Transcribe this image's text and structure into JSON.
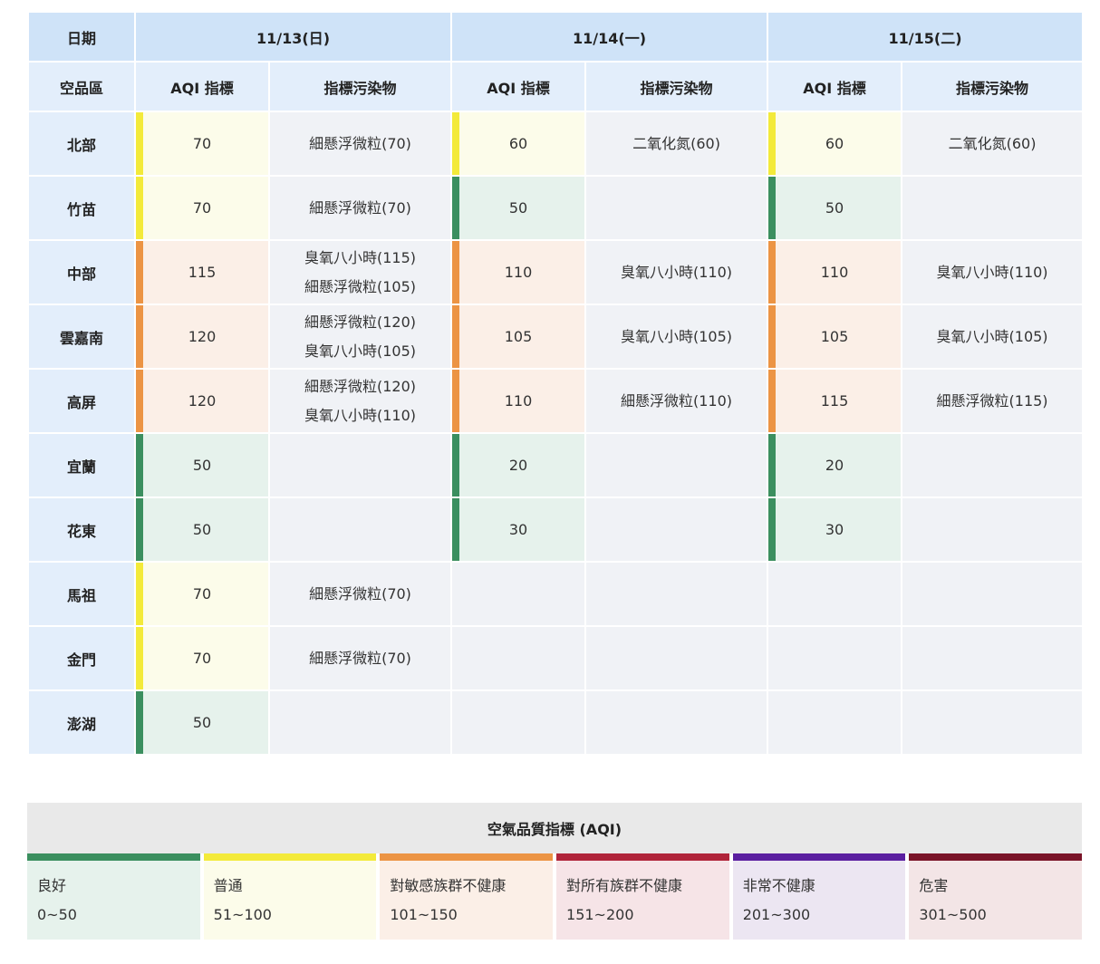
{
  "table": {
    "header": {
      "date_label": "日期",
      "dates": [
        "11/13(日)",
        "11/14(一)",
        "11/15(二)"
      ],
      "region_label": "空品區",
      "aqi_label": "AQI 指標",
      "pollutant_label": "指標污染物"
    },
    "rows": [
      {
        "region": "北部",
        "d1": {
          "aqi": "70",
          "level": "moderate",
          "p1": "細懸浮微粒(70)",
          "p2": ""
        },
        "d2": {
          "aqi": "60",
          "level": "moderate",
          "p1": "二氧化氮(60)",
          "p2": ""
        },
        "d3": {
          "aqi": "60",
          "level": "moderate",
          "p1": "二氧化氮(60)",
          "p2": ""
        }
      },
      {
        "region": "竹苗",
        "d1": {
          "aqi": "70",
          "level": "moderate",
          "p1": "細懸浮微粒(70)",
          "p2": ""
        },
        "d2": {
          "aqi": "50",
          "level": "good",
          "p1": "",
          "p2": ""
        },
        "d3": {
          "aqi": "50",
          "level": "good",
          "p1": "",
          "p2": ""
        }
      },
      {
        "region": "中部",
        "d1": {
          "aqi": "115",
          "level": "usg",
          "p1": "臭氧八小時(115)",
          "p2": "細懸浮微粒(105)"
        },
        "d2": {
          "aqi": "110",
          "level": "usg",
          "p1": "臭氧八小時(110)",
          "p2": ""
        },
        "d3": {
          "aqi": "110",
          "level": "usg",
          "p1": "臭氧八小時(110)",
          "p2": ""
        }
      },
      {
        "region": "雲嘉南",
        "d1": {
          "aqi": "120",
          "level": "usg",
          "p1": "細懸浮微粒(120)",
          "p2": "臭氧八小時(105)"
        },
        "d2": {
          "aqi": "105",
          "level": "usg",
          "p1": "臭氧八小時(105)",
          "p2": ""
        },
        "d3": {
          "aqi": "105",
          "level": "usg",
          "p1": "臭氧八小時(105)",
          "p2": ""
        }
      },
      {
        "region": "高屏",
        "d1": {
          "aqi": "120",
          "level": "usg",
          "p1": "細懸浮微粒(120)",
          "p2": "臭氧八小時(110)"
        },
        "d2": {
          "aqi": "110",
          "level": "usg",
          "p1": "細懸浮微粒(110)",
          "p2": ""
        },
        "d3": {
          "aqi": "115",
          "level": "usg",
          "p1": "細懸浮微粒(115)",
          "p2": ""
        }
      },
      {
        "region": "宜蘭",
        "d1": {
          "aqi": "50",
          "level": "good",
          "p1": "",
          "p2": ""
        },
        "d2": {
          "aqi": "20",
          "level": "good",
          "p1": "",
          "p2": ""
        },
        "d3": {
          "aqi": "20",
          "level": "good",
          "p1": "",
          "p2": ""
        }
      },
      {
        "region": "花東",
        "d1": {
          "aqi": "50",
          "level": "good",
          "p1": "",
          "p2": ""
        },
        "d2": {
          "aqi": "30",
          "level": "good",
          "p1": "",
          "p2": ""
        },
        "d3": {
          "aqi": "30",
          "level": "good",
          "p1": "",
          "p2": ""
        }
      },
      {
        "region": "馬祖",
        "d1": {
          "aqi": "70",
          "level": "moderate",
          "p1": "細懸浮微粒(70)",
          "p2": ""
        },
        "d2": {
          "aqi": "",
          "level": "none",
          "p1": "",
          "p2": ""
        },
        "d3": {
          "aqi": "",
          "level": "none",
          "p1": "",
          "p2": ""
        }
      },
      {
        "region": "金門",
        "d1": {
          "aqi": "70",
          "level": "moderate",
          "p1": "細懸浮微粒(70)",
          "p2": ""
        },
        "d2": {
          "aqi": "",
          "level": "none",
          "p1": "",
          "p2": ""
        },
        "d3": {
          "aqi": "",
          "level": "none",
          "p1": "",
          "p2": ""
        }
      },
      {
        "region": "澎湖",
        "d1": {
          "aqi": "50",
          "level": "good",
          "p1": "",
          "p2": ""
        },
        "d2": {
          "aqi": "",
          "level": "none",
          "p1": "",
          "p2": ""
        },
        "d3": {
          "aqi": "",
          "level": "none",
          "p1": "",
          "p2": ""
        }
      }
    ]
  },
  "legend": {
    "title": "空氣品質指標 (AQI)",
    "items": [
      {
        "name": "良好",
        "range": "0~50",
        "color": "#3b8f5f",
        "bg": "#e6f2ec"
      },
      {
        "name": "普通",
        "range": "51~100",
        "color": "#f3ea3a",
        "bg": "#fcfcea"
      },
      {
        "name": "對敏感族群不健康",
        "range": "101~150",
        "color": "#ec9444",
        "bg": "#fbefe7"
      },
      {
        "name": "對所有族群不健康",
        "range": "151~200",
        "color": "#b0243a",
        "bg": "#f6e4e7"
      },
      {
        "name": "非常不健康",
        "range": "201~300",
        "color": "#5b1fa0",
        "bg": "#ece6f2"
      },
      {
        "name": "危害",
        "range": "301~500",
        "color": "#7a1428",
        "bg": "#f3e5e6"
      }
    ]
  }
}
